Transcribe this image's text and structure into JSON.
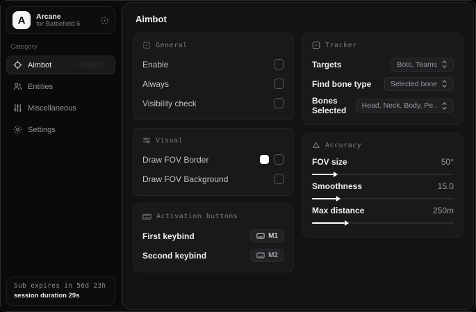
{
  "colors": {
    "accent_swatch": "#ffffff",
    "card_bg": "#19191b",
    "panel_bg": "#131315",
    "sidebar_bg": "#0a0a0b"
  },
  "sidebar": {
    "logo_letter": "A",
    "app_name": "Arcane",
    "app_subtitle": "for Battlefield 6",
    "category_label": "Category",
    "items": [
      {
        "label": "Aimbot",
        "icon": "crosshair-icon",
        "active": true
      },
      {
        "label": "Entities",
        "icon": "users-icon",
        "active": false
      },
      {
        "label": "Miscellaneous",
        "icon": "vertical-sliders-icon",
        "active": false
      },
      {
        "label": "Settings",
        "icon": "gear-icon",
        "active": false
      }
    ],
    "footer": {
      "sub_expires": "Sub expires in 56d 23h",
      "session_duration": "session duration 29s"
    }
  },
  "main": {
    "title": "Aimbot",
    "general": {
      "header": "General",
      "rows": [
        {
          "label": "Enable",
          "checked": false
        },
        {
          "label": "Always",
          "checked": false
        },
        {
          "label": "Visibility check",
          "checked": false
        }
      ]
    },
    "visual": {
      "header": "Visual",
      "rows": [
        {
          "label": "Draw FOV Border",
          "swatch_color": "#ffffff",
          "checked": false
        },
        {
          "label": "Draw FOV Background",
          "checked": false
        }
      ]
    },
    "activation": {
      "header": "Activation buttons",
      "rows": [
        {
          "label": "First keybind",
          "key": "M1"
        },
        {
          "label": "Second keybind",
          "key": "M2"
        }
      ]
    },
    "tracker": {
      "header": "Tracker",
      "rows": [
        {
          "label": "Targets",
          "value": "Bots, Teams"
        },
        {
          "label": "Find bone type",
          "value": "Selected bone"
        },
        {
          "label": "Bones Selected",
          "value": "Head, Neck, Body, Pe.."
        }
      ]
    },
    "accuracy": {
      "header": "Accuracy",
      "sliders": [
        {
          "label": "FOV size",
          "value": "50°",
          "fill_percent": 15
        },
        {
          "label": "Smoothness",
          "value": "15.0",
          "fill_percent": 17
        },
        {
          "label": "Max distance",
          "value": "250m",
          "fill_percent": 23
        }
      ]
    }
  }
}
